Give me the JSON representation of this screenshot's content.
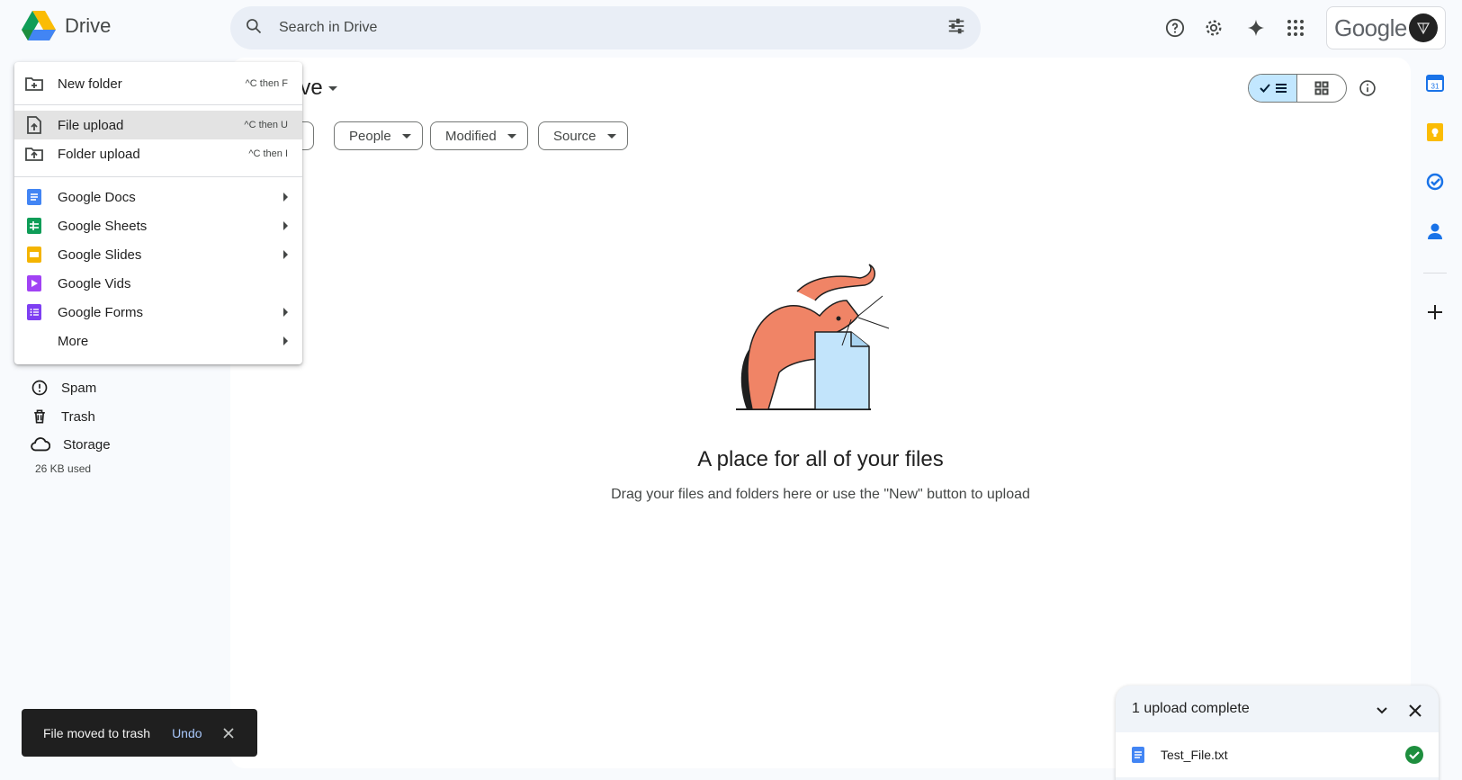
{
  "header": {
    "app_name": "Drive",
    "search_placeholder": "Search in Drive",
    "account_label": "Google"
  },
  "main": {
    "title_fragment": "rive",
    "filters": [
      {
        "label": "People"
      },
      {
        "label": "Modified"
      },
      {
        "label": "Source"
      }
    ],
    "empty_title": "A place for all of your files",
    "empty_subtitle": "Drag your files and folders here or use the \"New\" button to upload"
  },
  "nav": {
    "items": [
      {
        "label": "Spam",
        "icon": "spam-icon"
      },
      {
        "label": "Trash",
        "icon": "trash-icon"
      },
      {
        "label": "Storage",
        "icon": "cloud-icon"
      }
    ],
    "storage_used": "26 KB used"
  },
  "new_menu": {
    "items": [
      {
        "label": "New folder",
        "shortcut": "^C then F",
        "icon": "new-folder-icon"
      },
      {
        "label": "File upload",
        "shortcut": "^C then U",
        "icon": "file-upload-icon"
      },
      {
        "label": "Folder upload",
        "shortcut": "^C then I",
        "icon": "folder-upload-icon"
      },
      {
        "label": "Google Docs",
        "icon": "google-docs-icon"
      },
      {
        "label": "Google Sheets",
        "icon": "google-sheets-icon"
      },
      {
        "label": "Google Slides",
        "icon": "google-slides-icon"
      },
      {
        "label": "Google Vids",
        "icon": "google-vids-icon"
      },
      {
        "label": "Google Forms",
        "icon": "google-forms-icon"
      },
      {
        "label": "More"
      }
    ]
  },
  "snackbar": {
    "message": "File moved to trash",
    "action": "Undo"
  },
  "upload_panel": {
    "title": "1 upload complete",
    "file_name": "Test_File.txt"
  },
  "right_rail": {
    "calendar_day": "31"
  },
  "colors": {
    "accent": "#0b57d0",
    "docs": "#4285f4",
    "sheets": "#0f9d58",
    "slides": "#f4b400",
    "vids": "#a142f4",
    "forms": "#7e3ff2",
    "success": "#1e8e3e"
  }
}
